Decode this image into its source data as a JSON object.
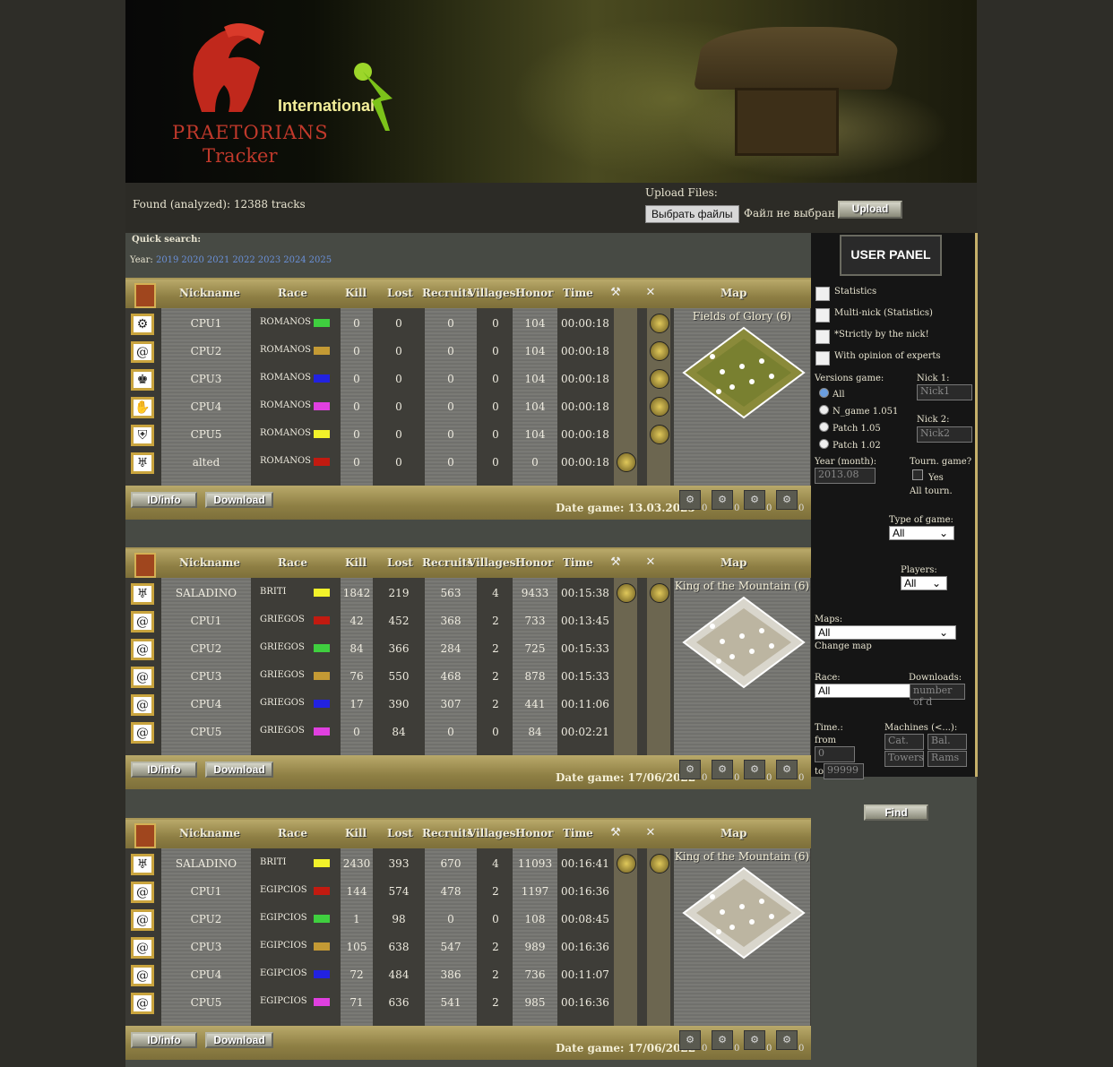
{
  "header": {
    "logo_line1": "PRAETORIANS",
    "logo_line2": "Tracker",
    "logo_badge": "International"
  },
  "topbar": {
    "found_text": "Found (analyzed): 12388 tracks",
    "upload_label": "Upload Files:",
    "choose_files": "Выбрать файлы",
    "no_file": "Файл не выбран",
    "upload_button": "Upload"
  },
  "quick_search": {
    "label": "Quick search:",
    "year_label": "Year:",
    "years": [
      "2019",
      "2020",
      "2021",
      "2022",
      "2023",
      "2024",
      "2025"
    ]
  },
  "columns": {
    "nickname": "Nickname",
    "race": "Race",
    "kill": "Kill",
    "lost": "Lost",
    "recruits": "Recruits",
    "villages": "Villages",
    "honor": "Honor",
    "time": "Time",
    "map": "Map"
  },
  "buttons": {
    "id_info": "ID/info",
    "download": "Download",
    "find": "Find"
  },
  "games": [
    {
      "map_name": "Fields of Glory (6)",
      "date": "Date game: 13.03.2025",
      "machines": [
        "0",
        "0",
        "0",
        "0"
      ],
      "rows": [
        {
          "nick": "CPU1",
          "race": "ROMANOS",
          "color": "#3fcf3f",
          "kill": "0",
          "lost": "0",
          "recruits": "0",
          "villages": "0",
          "honor": "104",
          "time": "00:00:18",
          "icon": "chariot-icon"
        },
        {
          "nick": "CPU2",
          "race": "ROMANOS",
          "color": "#c49a34",
          "kill": "0",
          "lost": "0",
          "recruits": "0",
          "villages": "0",
          "honor": "104",
          "time": "00:00:18",
          "icon": "spiral-icon"
        },
        {
          "nick": "CPU3",
          "race": "ROMANOS",
          "color": "#2222e0",
          "kill": "0",
          "lost": "0",
          "recruits": "0",
          "villages": "0",
          "honor": "104",
          "time": "00:00:18",
          "icon": "trophy-icon"
        },
        {
          "nick": "CPU4",
          "race": "ROMANOS",
          "color": "#e040e0",
          "kill": "0",
          "lost": "0",
          "recruits": "0",
          "villages": "0",
          "honor": "104",
          "time": "00:00:18",
          "icon": "hand-icon"
        },
        {
          "nick": "CPU5",
          "race": "ROMANOS",
          "color": "#f2f22a",
          "kill": "0",
          "lost": "0",
          "recruits": "0",
          "villages": "0",
          "honor": "104",
          "time": "00:00:18",
          "icon": "shield-icon"
        },
        {
          "nick": "alted",
          "race": "ROMANOS",
          "color": "#c21a10",
          "kill": "0",
          "lost": "0",
          "recruits": "0",
          "villages": "0",
          "honor": "0",
          "time": "00:00:18",
          "icon": "eagle-icon"
        }
      ]
    },
    {
      "map_name": "King of the Mountain (6)",
      "date": "Date game: 17/06/2022",
      "machines": [
        "0",
        "0",
        "0",
        "0"
      ],
      "rows": [
        {
          "nick": "SALADINO",
          "race": "BRITI",
          "color": "#f2f22a",
          "kill": "1842",
          "lost": "219",
          "recruits": "563",
          "villages": "4",
          "honor": "9433",
          "time": "00:15:38",
          "icon": "eagle-icon"
        },
        {
          "nick": "CPU1",
          "race": "GRIEGOS",
          "color": "#c21a10",
          "kill": "42",
          "lost": "452",
          "recruits": "368",
          "villages": "2",
          "honor": "733",
          "time": "00:13:45",
          "icon": "spiral-icon"
        },
        {
          "nick": "CPU2",
          "race": "GRIEGOS",
          "color": "#3fcf3f",
          "kill": "84",
          "lost": "366",
          "recruits": "284",
          "villages": "2",
          "honor": "725",
          "time": "00:15:33",
          "icon": "spiral-icon"
        },
        {
          "nick": "CPU3",
          "race": "GRIEGOS",
          "color": "#c49a34",
          "kill": "76",
          "lost": "550",
          "recruits": "468",
          "villages": "2",
          "honor": "878",
          "time": "00:15:33",
          "icon": "spiral-icon"
        },
        {
          "nick": "CPU4",
          "race": "GRIEGOS",
          "color": "#2222e0",
          "kill": "17",
          "lost": "390",
          "recruits": "307",
          "villages": "2",
          "honor": "441",
          "time": "00:11:06",
          "icon": "spiral-icon"
        },
        {
          "nick": "CPU5",
          "race": "GRIEGOS",
          "color": "#e040e0",
          "kill": "0",
          "lost": "84",
          "recruits": "0",
          "villages": "0",
          "honor": "84",
          "time": "00:02:21",
          "icon": "spiral-icon"
        }
      ]
    },
    {
      "map_name": "King of the Mountain (6)",
      "date": "Date game: 17/06/2022",
      "machines": [
        "0",
        "0",
        "0",
        "0"
      ],
      "rows": [
        {
          "nick": "SALADINO",
          "race": "BRITI",
          "color": "#f2f22a",
          "kill": "2430",
          "lost": "393",
          "recruits": "670",
          "villages": "4",
          "honor": "11093",
          "time": "00:16:41",
          "icon": "eagle-icon"
        },
        {
          "nick": "CPU1",
          "race": "EGIPCIOS",
          "color": "#c21a10",
          "kill": "144",
          "lost": "574",
          "recruits": "478",
          "villages": "2",
          "honor": "1197",
          "time": "00:16:36",
          "icon": "spiral-icon"
        },
        {
          "nick": "CPU2",
          "race": "EGIPCIOS",
          "color": "#3fcf3f",
          "kill": "1",
          "lost": "98",
          "recruits": "0",
          "villages": "0",
          "honor": "108",
          "time": "00:08:45",
          "icon": "spiral-icon"
        },
        {
          "nick": "CPU3",
          "race": "EGIPCIOS",
          "color": "#c49a34",
          "kill": "105",
          "lost": "638",
          "recruits": "547",
          "villages": "2",
          "honor": "989",
          "time": "00:16:36",
          "icon": "spiral-icon"
        },
        {
          "nick": "CPU4",
          "race": "EGIPCIOS",
          "color": "#2222e0",
          "kill": "72",
          "lost": "484",
          "recruits": "386",
          "villages": "2",
          "honor": "736",
          "time": "00:11:07",
          "icon": "spiral-icon"
        },
        {
          "nick": "CPU5",
          "race": "EGIPCIOS",
          "color": "#e040e0",
          "kill": "71",
          "lost": "636",
          "recruits": "541",
          "villages": "2",
          "honor": "985",
          "time": "00:16:36",
          "icon": "spiral-icon"
        }
      ]
    }
  ],
  "panel": {
    "title": "USER PANEL",
    "statistics": "Statistics",
    "multinick": "Multi-nick (Statistics)",
    "strict": "*Strictly by the nick!",
    "experts": "With opinion of experts",
    "versions_label": "Versions game:",
    "v_all": "All",
    "v_ngame": "N_game 1.051",
    "v_105": "Patch 1.05",
    "v_102": "Patch 1.02",
    "nick1_label": "Nick 1:",
    "nick1_ph": "Nick1",
    "nick2_label": "Nick 2:",
    "nick2_ph": "Nick2",
    "year_label": "Year (month):",
    "year_ph": "2013.08",
    "tourn_label": "Tourn. game?",
    "tourn_yes": "Yes",
    "tourn_all": "All tourn.",
    "type_label": "Type of game:",
    "type_value": "All",
    "players_label": "Players:",
    "players_value": "All",
    "maps_label": "Maps:",
    "maps_value": "All",
    "change_map": "Change map",
    "race_label": "Race:",
    "race_value": "All",
    "downloads_label": "Downloads:",
    "downloads_ph": "number of d",
    "time_label": "Time.:",
    "from_label": "from",
    "from_ph": "0",
    "to_label": "to",
    "to_ph": "99999",
    "machines_label": "Machines (<...):",
    "cat_ph": "Cat.",
    "bal_ph": "Bal.",
    "towers_ph": "Towers",
    "rams_ph": "Rams"
  }
}
